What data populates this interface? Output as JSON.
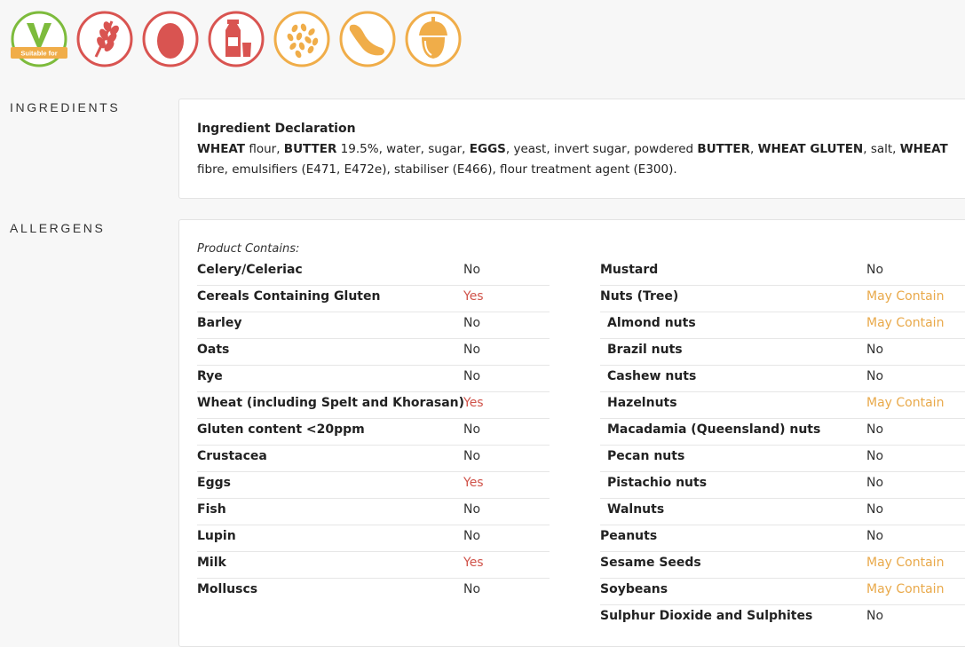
{
  "icons": [
    {
      "name": "vegetarian-icon",
      "label": "Suitable for",
      "color": "#7dbb3c"
    },
    {
      "name": "cereals-gluten-icon",
      "color": "#d95451"
    },
    {
      "name": "egg-icon",
      "color": "#d95451"
    },
    {
      "name": "milk-icon",
      "color": "#d95451"
    },
    {
      "name": "sesame-icon",
      "color": "#f0ad49"
    },
    {
      "name": "soybean-icon",
      "color": "#f0ad49"
    },
    {
      "name": "tree-nut-icon",
      "color": "#f0ad49"
    }
  ],
  "colors": {
    "yes": "#d0534a",
    "may_contain": "#e9a94a",
    "no": "#333333"
  },
  "ingredients": {
    "label": "INGREDIENTS",
    "title": "Ingredient Declaration",
    "parts": [
      {
        "text": "WHEAT",
        "bold": true
      },
      {
        "text": " flour, ",
        "bold": false
      },
      {
        "text": "BUTTER",
        "bold": true
      },
      {
        "text": " 19.5%, water, sugar, ",
        "bold": false
      },
      {
        "text": "EGGS",
        "bold": true
      },
      {
        "text": ", yeast, invert sugar, powdered ",
        "bold": false
      },
      {
        "text": "BUTTER",
        "bold": true
      },
      {
        "text": ", ",
        "bold": false
      },
      {
        "text": "WHEAT GLUTEN",
        "bold": true
      },
      {
        "text": ", salt, ",
        "bold": false
      },
      {
        "text": "WHEAT",
        "bold": true
      },
      {
        "text": " fibre, emulsifiers (E471, E472e), stabiliser (E466), flour treatment agent (E300).",
        "bold": false
      }
    ]
  },
  "allergens": {
    "label": "ALLERGENS",
    "contains_label": "Product Contains:",
    "left": [
      {
        "name": "Celery/Celeriac",
        "value": "No",
        "status": "no",
        "sub": false
      },
      {
        "name": "Cereals Containing Gluten",
        "value": "Yes",
        "status": "yes",
        "sub": false
      },
      {
        "name": "Barley",
        "value": "No",
        "status": "no",
        "sub": false
      },
      {
        "name": "Oats",
        "value": "No",
        "status": "no",
        "sub": false
      },
      {
        "name": "Rye",
        "value": "No",
        "status": "no",
        "sub": false
      },
      {
        "name": "Wheat (including Spelt and Khorasan)",
        "value": "Yes",
        "status": "yes",
        "sub": false
      },
      {
        "name": "Gluten content <20ppm",
        "value": "No",
        "status": "no",
        "sub": false
      },
      {
        "name": "Crustacea",
        "value": "No",
        "status": "no",
        "sub": false
      },
      {
        "name": "Eggs",
        "value": "Yes",
        "status": "yes",
        "sub": false
      },
      {
        "name": "Fish",
        "value": "No",
        "status": "no",
        "sub": false
      },
      {
        "name": "Lupin",
        "value": "No",
        "status": "no",
        "sub": false
      },
      {
        "name": "Milk",
        "value": "Yes",
        "status": "yes",
        "sub": false
      },
      {
        "name": "Molluscs",
        "value": "No",
        "status": "no",
        "sub": false
      }
    ],
    "right": [
      {
        "name": "Mustard",
        "value": "No",
        "status": "no",
        "sub": false
      },
      {
        "name": "Nuts (Tree)",
        "value": "May Contain",
        "status": "may",
        "sub": false
      },
      {
        "name": "Almond nuts",
        "value": "May Contain",
        "status": "may",
        "sub": true
      },
      {
        "name": "Brazil nuts",
        "value": "No",
        "status": "no",
        "sub": true
      },
      {
        "name": "Cashew nuts",
        "value": "No",
        "status": "no",
        "sub": true
      },
      {
        "name": "Hazelnuts",
        "value": "May Contain",
        "status": "may",
        "sub": true
      },
      {
        "name": "Macadamia (Queensland) nuts",
        "value": "No",
        "status": "no",
        "sub": true
      },
      {
        "name": "Pecan nuts",
        "value": "No",
        "status": "no",
        "sub": true
      },
      {
        "name": "Pistachio nuts",
        "value": "No",
        "status": "no",
        "sub": true
      },
      {
        "name": "Walnuts",
        "value": "No",
        "status": "no",
        "sub": true
      },
      {
        "name": "Peanuts",
        "value": "No",
        "status": "no",
        "sub": false
      },
      {
        "name": "Sesame Seeds",
        "value": "May Contain",
        "status": "may",
        "sub": false
      },
      {
        "name": "Soybeans",
        "value": "May Contain",
        "status": "may",
        "sub": false
      },
      {
        "name": "Sulphur Dioxide and Sulphites",
        "value": "No",
        "status": "no",
        "sub": false
      }
    ]
  }
}
